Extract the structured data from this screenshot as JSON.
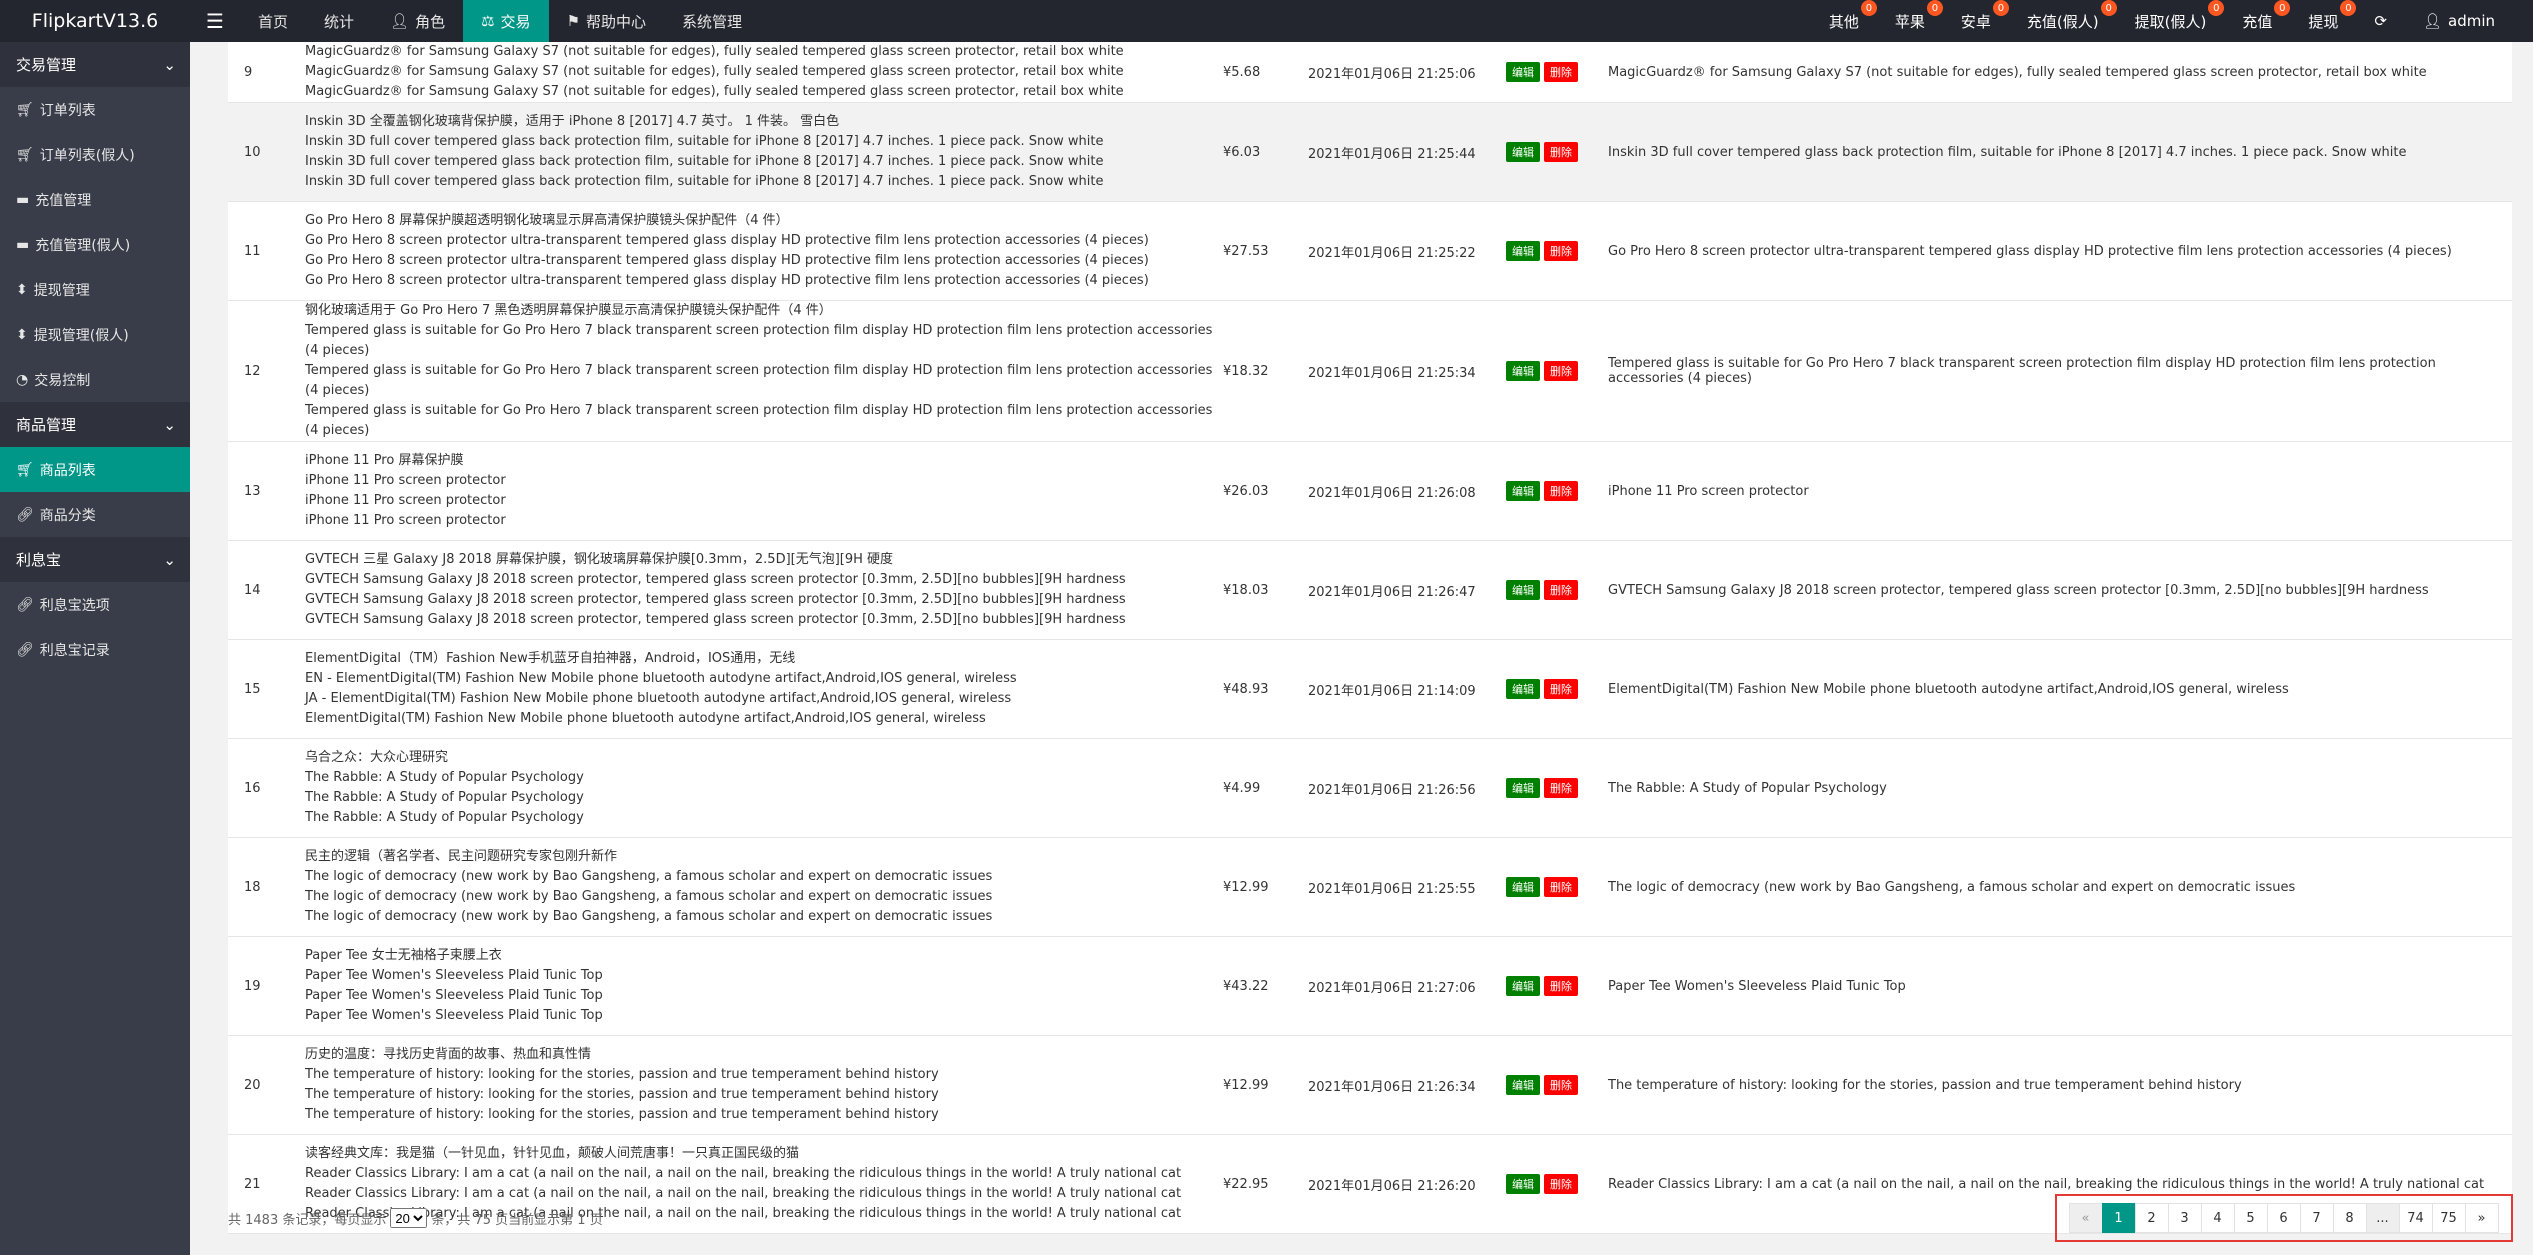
{
  "app": {
    "title": "FlipkartV13.6"
  },
  "topnav": [
    {
      "label": "首页"
    },
    {
      "label": "统计"
    },
    {
      "label": "角色"
    },
    {
      "label": "交易"
    },
    {
      "label": "帮助中心"
    },
    {
      "label": "系统管理"
    }
  ],
  "topright": [
    {
      "label": "其他",
      "badge": "0"
    },
    {
      "label": "苹果",
      "badge": "0"
    },
    {
      "label": "安卓",
      "badge": "0"
    },
    {
      "label": "充值(假人)",
      "badge": "0"
    },
    {
      "label": "提取(假人)",
      "badge": "0"
    },
    {
      "label": "充值",
      "badge": "0"
    },
    {
      "label": "提现",
      "badge": "0"
    }
  ],
  "admin": {
    "label": "admin"
  },
  "sidebar": {
    "groups": [
      {
        "label": "交易管理",
        "items": [
          "订单列表",
          "订单列表(假人)",
          "充值管理",
          "充值管理(假人)",
          "提现管理",
          "提现管理(假人)",
          "交易控制"
        ]
      },
      {
        "label": "商品管理",
        "items": [
          "商品列表",
          "商品分类"
        ]
      },
      {
        "label": "利息宝",
        "items": [
          "利息宝选项",
          "利息宝记录"
        ]
      }
    ]
  },
  "buttons": {
    "edit": "编辑",
    "delete": "删除"
  },
  "rows": [
    {
      "id": "9",
      "lines": [
        "MagicGuardz® for Samsung Galaxy S7 (not suitable for edges), fully sealed tempered glass screen protector, retail box white",
        "MagicGuardz® for Samsung Galaxy S7 (not suitable for edges), fully sealed tempered glass screen protector, retail box white",
        "MagicGuardz® for Samsung Galaxy S7 (not suitable for edges), fully sealed tempered glass screen protector, retail box white"
      ],
      "price": "¥5.68",
      "time": "2021年01月06日 21:25:06",
      "en": "MagicGuardz® for Samsung Galaxy S7 (not suitable for edges), fully sealed tempered glass screen protector, retail box white"
    },
    {
      "id": "10",
      "lines": [
        "Inskin 3D 全覆盖钢化玻璃背保护膜，适用于 iPhone 8 [2017] 4.7 英寸。 1 件装。 雪白色",
        "Inskin 3D full cover tempered glass back protection film, suitable for iPhone 8 [2017] 4.7 inches. 1 piece pack. Snow white",
        "Inskin 3D full cover tempered glass back protection film, suitable for iPhone 8 [2017] 4.7 inches. 1 piece pack. Snow white",
        "Inskin 3D full cover tempered glass back protection film, suitable for iPhone 8 [2017] 4.7 inches. 1 piece pack. Snow white"
      ],
      "price": "¥6.03",
      "time": "2021年01月06日 21:25:44",
      "en": "Inskin 3D full cover tempered glass back protection film, suitable for iPhone 8 [2017] 4.7 inches. 1 piece pack. Snow white"
    },
    {
      "id": "11",
      "lines": [
        "Go Pro Hero 8 屏幕保护膜超透明钢化玻璃显示屏高清保护膜镜头保护配件（4 件）",
        "Go Pro Hero 8 screen protector ultra-transparent tempered glass display HD protective film lens protection accessories (4 pieces)",
        "Go Pro Hero 8 screen protector ultra-transparent tempered glass display HD protective film lens protection accessories (4 pieces)",
        "Go Pro Hero 8 screen protector ultra-transparent tempered glass display HD protective film lens protection accessories (4 pieces)"
      ],
      "price": "¥27.53",
      "time": "2021年01月06日 21:25:22",
      "en": "Go Pro Hero 8 screen protector ultra-transparent tempered glass display HD protective film lens protection accessories (4 pieces)"
    },
    {
      "id": "12",
      "lines": [
        "钢化玻璃适用于 Go Pro Hero 7 黑色透明屏幕保护膜显示高清保护膜镜头保护配件（4 件）",
        "Tempered glass is suitable for Go Pro Hero 7 black transparent screen protection film display HD protection film lens protection accessories (4 pieces)",
        "Tempered glass is suitable for Go Pro Hero 7 black transparent screen protection film display HD protection film lens protection accessories (4 pieces)",
        "Tempered glass is suitable for Go Pro Hero 7 black transparent screen protection film display HD protection film lens protection accessories (4 pieces)"
      ],
      "price": "¥18.32",
      "time": "2021年01月06日 21:25:34",
      "en": "Tempered glass is suitable for Go Pro Hero 7 black transparent screen protection film display HD protection film lens protection accessories (4 pieces)"
    },
    {
      "id": "13",
      "lines": [
        "iPhone 11 Pro 屏幕保护膜",
        "iPhone 11 Pro screen protector",
        "iPhone 11 Pro screen protector",
        "iPhone 11 Pro screen protector"
      ],
      "price": "¥26.03",
      "time": "2021年01月06日 21:26:08",
      "en": "iPhone 11 Pro screen protector"
    },
    {
      "id": "14",
      "lines": [
        "GVTECH 三星 Galaxy J8 2018 屏幕保护膜，钢化玻璃屏幕保护膜[0.3mm，2.5D][无气泡][9H 硬度",
        "GVTECH Samsung Galaxy J8 2018 screen protector, tempered glass screen protector [0.3mm, 2.5D][no bubbles][9H hardness",
        "GVTECH Samsung Galaxy J8 2018 screen protector, tempered glass screen protector [0.3mm, 2.5D][no bubbles][9H hardness",
        "GVTECH Samsung Galaxy J8 2018 screen protector, tempered glass screen protector [0.3mm, 2.5D][no bubbles][9H hardness"
      ],
      "price": "¥18.03",
      "time": "2021年01月06日 21:26:47",
      "en": "GVTECH Samsung Galaxy J8 2018 screen protector, tempered glass screen protector [0.3mm, 2.5D][no bubbles][9H hardness"
    },
    {
      "id": "15",
      "lines": [
        "ElementDigital（TM）Fashion New手机蓝牙自拍神器，Android，IOS通用，无线",
        "EN - ElementDigital(TM) Fashion New Mobile phone bluetooth autodyne artifact,Android,IOS general, wireless",
        "JA - ElementDigital(TM) Fashion New Mobile phone bluetooth autodyne artifact,Android,IOS general, wireless",
        "ElementDigital(TM) Fashion New Mobile phone bluetooth autodyne artifact,Android,IOS general, wireless"
      ],
      "price": "¥48.93",
      "time": "2021年01月06日 21:14:09",
      "en": "ElementDigital(TM) Fashion New Mobile phone bluetooth autodyne artifact,Android,IOS general, wireless"
    },
    {
      "id": "16",
      "lines": [
        "乌合之众：大众心理研究",
        "The Rabble: A Study of Popular Psychology",
        "The Rabble: A Study of Popular Psychology",
        "The Rabble: A Study of Popular Psychology"
      ],
      "price": "¥4.99",
      "time": "2021年01月06日 21:26:56",
      "en": "The Rabble: A Study of Popular Psychology"
    },
    {
      "id": "18",
      "lines": [
        "民主的逻辑（著名学者、民主问题研究专家包刚升新作",
        "The logic of democracy (new work by Bao Gangsheng, a famous scholar and expert on democratic issues",
        "The logic of democracy (new work by Bao Gangsheng, a famous scholar and expert on democratic issues",
        "The logic of democracy (new work by Bao Gangsheng, a famous scholar and expert on democratic issues"
      ],
      "price": "¥12.99",
      "time": "2021年01月06日 21:25:55",
      "en": "The logic of democracy (new work by Bao Gangsheng, a famous scholar and expert on democratic issues"
    },
    {
      "id": "19",
      "lines": [
        "Paper Tee 女士无袖格子束腰上衣",
        "Paper Tee Women's Sleeveless Plaid Tunic Top",
        "Paper Tee Women's Sleeveless Plaid Tunic Top",
        "Paper Tee Women's Sleeveless Plaid Tunic Top"
      ],
      "price": "¥43.22",
      "time": "2021年01月06日 21:27:06",
      "en": "Paper Tee Women's Sleeveless Plaid Tunic Top"
    },
    {
      "id": "20",
      "lines": [
        "历史的温度：寻找历史背面的故事、热血和真性情",
        "The temperature of history: looking for the stories, passion and true temperament behind history",
        "The temperature of history: looking for the stories, passion and true temperament behind history",
        "The temperature of history: looking for the stories, passion and true temperament behind history"
      ],
      "price": "¥12.99",
      "time": "2021年01月06日 21:26:34",
      "en": "The temperature of history: looking for the stories, passion and true temperament behind history"
    },
    {
      "id": "21",
      "lines": [
        "读客经典文库：我是猫（一针见血，针针见血，颠破人间荒唐事！一只真正国民级的猫",
        "Reader Classics Library: I am a cat (a nail on the nail, a nail on the nail, breaking the ridiculous things in the world! A truly national cat",
        "Reader Classics Library: I am a cat (a nail on the nail, a nail on the nail, breaking the ridiculous things in the world! A truly national cat",
        "Reader Classics Library: I am a cat (a nail on the nail, a nail on the nail, breaking the ridiculous things in the world! A truly national cat"
      ],
      "price": "¥22.95",
      "time": "2021年01月06日 21:26:20",
      "en": "Reader Classics Library: I am a cat (a nail on the nail, a nail on the nail, breaking the ridiculous things in the world! A truly national cat"
    }
  ],
  "footer": {
    "prefix": "共 1483 条记录，每页显示",
    "page_size": "20",
    "suffix": "条，共 75 页当前显示第 1 页"
  },
  "pagination": {
    "prev": "«",
    "pages": [
      "1",
      "2",
      "3",
      "4",
      "5",
      "6",
      "7",
      "8"
    ],
    "ellipsis": "...",
    "last_pages": [
      "74",
      "75"
    ],
    "next": "»"
  }
}
